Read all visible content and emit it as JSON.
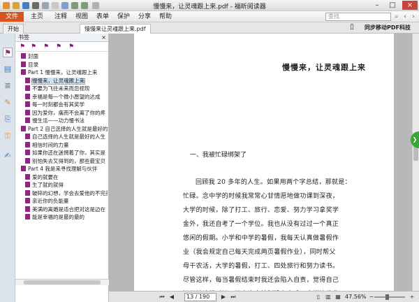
{
  "window": {
    "title": "慢慢来，让灵魂跟上来.pdf - 福昕阅读器"
  },
  "menu": {
    "items": [
      "文件",
      "主页",
      "注释",
      "视图",
      "表单",
      "保护",
      "分享",
      "帮助"
    ],
    "search_placeholder": "查找"
  },
  "tabs": [
    {
      "label": "开始"
    },
    {
      "label": "慢慢来让灵魂跟上来.pdf"
    }
  ],
  "ad": {
    "text": "同步移动PDF科技"
  },
  "sidebar": {
    "title": "书签",
    "close": "×"
  },
  "bookmarks": [
    {
      "level": 1,
      "label": "封面"
    },
    {
      "level": 1,
      "label": "目录"
    },
    {
      "level": 1,
      "label": "Part 1 慢慢来，让灵魂跟上来",
      "expanded": true
    },
    {
      "level": 2,
      "label": "慢慢来，让灵魂跟上来"
    },
    {
      "level": 2,
      "label": "不要为飞往未来而忽视现"
    },
    {
      "level": 2,
      "label": "幸福是每一个微小愿望的达成"
    },
    {
      "level": 2,
      "label": "每一时刻都会有其奖学"
    },
    {
      "level": 2,
      "label": "因为爱你，痛而不会离了你的疼"
    },
    {
      "level": 2,
      "label": "慢生活——功力慢书法"
    },
    {
      "level": 1,
      "label": "Part 2 自己选择的人生就是最好的人",
      "expanded": true
    },
    {
      "level": 2,
      "label": "自己选择的人生就是最好的人生"
    },
    {
      "level": 2,
      "label": "相信时间的力量"
    },
    {
      "level": 2,
      "label": "如果你还在迷惘着了你，其实是"
    },
    {
      "level": 2,
      "label": "别怕失去又得到的，那些最宝贝"
    },
    {
      "level": 1,
      "label": "Part 4 我是来寻找理解与伙伴",
      "expanded": true
    },
    {
      "level": 2,
      "label": "爱的就要在"
    },
    {
      "level": 2,
      "label": "生了就的就得"
    },
    {
      "level": 2,
      "label": "破碎的幻想，学会去爱他的不完美"
    },
    {
      "level": 2,
      "label": "亲近你的负能量"
    },
    {
      "level": 2,
      "label": "美满的离婚是适合把对这是边在"
    },
    {
      "level": 2,
      "label": "能是幸福的是最的最的"
    }
  ],
  "document": {
    "chapter_title": "慢慢来，让灵魂跟上来",
    "section_title": "一、我被忙碌绑架了",
    "paragraph_lines": [
      "回顾我 20 多年的人生。如果用两个字总结，那就是：",
      "忙碌。念中学的时候我常常心甘情愿地做功课到深夜，",
      "大学的时候，除了打工、旅行、恋爱、努力学习拿奖学",
      "金外，我还自考了一个学位。我也从没有过过一个真正",
      "悠闲的假期。小学和中学的暑假，我每天认真做暑假作",
      "业（我会规定自己每天完成两页暑假作业），同时帮父",
      "母干农活，大学的暑假，打工、四处旅行和努力读书。",
      "尽管这样，每当暑假结束时我还会陷入自责，觉得自己",
      "还不够珍惜时间，还有许多计划没有完成。大学毕业参"
    ]
  },
  "status": {
    "page_display": "13 / 190",
    "zoom": "47.56%",
    "zoom_level": 0.4756
  },
  "icons": {
    "accent": "#d9531e",
    "bookmark_color": "#8b2a7d",
    "green_button": "#3aa53a"
  }
}
